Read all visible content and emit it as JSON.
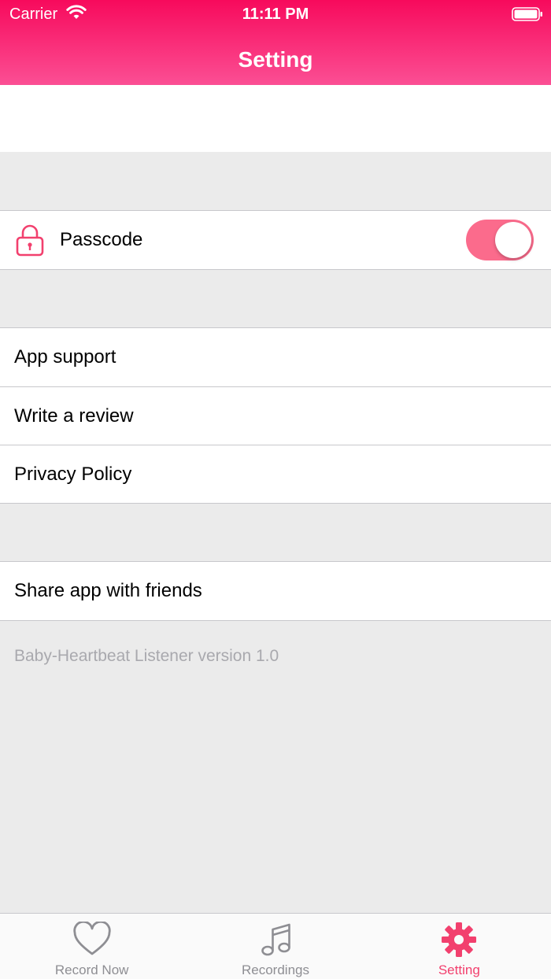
{
  "status_bar": {
    "carrier": "Carrier",
    "time": "11:11 PM"
  },
  "nav": {
    "title": "Setting"
  },
  "passcode": {
    "label": "Passcode",
    "enabled": true,
    "icon": "lock-icon"
  },
  "support_items": [
    {
      "label": "App support"
    },
    {
      "label": "Write a review"
    },
    {
      "label": "Privacy Policy"
    }
  ],
  "share": {
    "label": "Share app with friends"
  },
  "footer": {
    "version_text": "Baby-Heartbeat Listener version 1.0"
  },
  "tabs": [
    {
      "label": "Record Now",
      "icon": "heart-icon",
      "active": false
    },
    {
      "label": "Recordings",
      "icon": "music-note-icon",
      "active": false
    },
    {
      "label": "Setting",
      "icon": "gear-icon",
      "active": true
    }
  ],
  "colors": {
    "header_top": "#f70a5c",
    "header_bottom": "#fb4f94",
    "accent": "#f2406e",
    "toggle_on": "#fb6b8c",
    "background": "#ebebeb",
    "inactive_tab": "#8e8e93"
  }
}
